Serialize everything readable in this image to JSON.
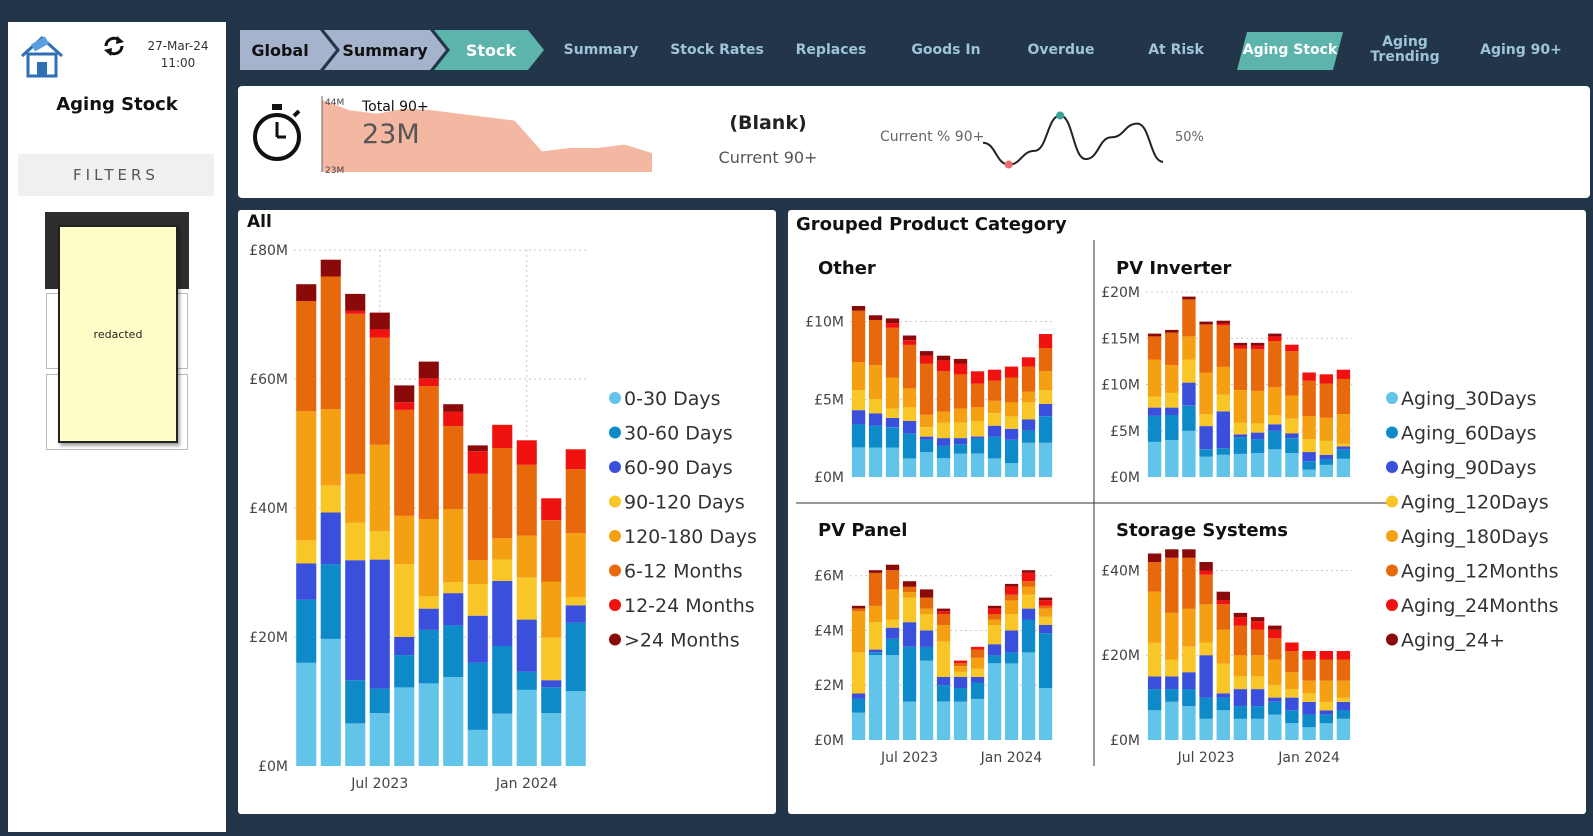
{
  "header": {
    "date": "27-Mar-24",
    "time": "11:00",
    "title": "Aging Stock",
    "filters_label": "FILTERS",
    "redacted_label": "redacted"
  },
  "breadcrumbs": [
    "Global",
    "Summary",
    "Stock"
  ],
  "tabs": [
    {
      "label": "Summary",
      "active": false
    },
    {
      "label": "Stock Rates",
      "active": false
    },
    {
      "label": "Replaces",
      "active": false
    },
    {
      "label": "Goods In",
      "active": false
    },
    {
      "label": "Overdue",
      "active": false
    },
    {
      "label": "At Risk",
      "active": false
    },
    {
      "label": "Aging Stock",
      "active": true
    },
    {
      "label": "Aging Trending",
      "active": false
    },
    {
      "label": "Aging 90+",
      "active": false
    }
  ],
  "kpi": {
    "sparkline_label": "Total 90+",
    "sparkline_value": "23M",
    "spark_max": "44M",
    "spark_min": "23M",
    "sparkline_values": [
      44,
      41,
      40,
      41.5,
      41,
      40,
      39,
      38,
      29,
      30,
      30,
      31,
      28.5
    ],
    "blank_value": "(Blank)",
    "blank_label": "Current 90+",
    "pct_label": "Current % 90+",
    "pct_value": "50%",
    "pct_values": [
      50,
      42,
      47,
      60,
      44,
      52,
      57,
      43
    ]
  },
  "colors": {
    "0-30": "#62c4e8",
    "30-60": "#0e8ac8",
    "60-90": "#3a4fdc",
    "90-120": "#f9c628",
    "120-180": "#f4a012",
    "6-12": "#e8680c",
    "12-24": "#f0120e",
    "24+": "#8a0a0a",
    "spark_fill": "#f4b7a2",
    "nav_crumb": "#a6b3cc",
    "nav_active": "#5cb4ad",
    "pct_high": "#3aa39b",
    "pct_low": "#f06a6a"
  },
  "chart_data": [
    {
      "type": "bar",
      "stacked": true,
      "title": "All",
      "ylim": [
        0,
        80
      ],
      "yticks": [
        "£0M",
        "£20M",
        "£40M",
        "£60M",
        "£80M"
      ],
      "xticks": [
        "Jul 2023",
        "Jan 2024"
      ],
      "categories": [
        "2023-04",
        "2023-05",
        "2023-06",
        "2023-07",
        "2023-08",
        "2023-09",
        "2023-10",
        "2023-11",
        "2023-12",
        "2024-01",
        "2024-02",
        "2024-03"
      ],
      "legend": [
        "0-30 Days",
        "30-60 Days",
        "60-90 Days",
        "90-120 Days",
        "120-180 Days",
        "6-12 Months",
        "12-24 Months",
        ">24 Months"
      ],
      "series": [
        {
          "name": "0-30 Days",
          "values": [
            16,
            19.7,
            6.6,
            8.2,
            12.2,
            12.8,
            13.8,
            5.6,
            8.1,
            11.8,
            8.2,
            11.6
          ]
        },
        {
          "name": "30-60 Days",
          "values": [
            9.8,
            11.6,
            6.7,
            3.8,
            5,
            8.3,
            8,
            10.4,
            10.5,
            2.8,
            4,
            10.6
          ]
        },
        {
          "name": "60-90 Days",
          "values": [
            5.6,
            8,
            18.6,
            20,
            2.8,
            3.3,
            5,
            7.3,
            10.1,
            8.1,
            1.1,
            2.7
          ]
        },
        {
          "name": "90-120 Days",
          "values": [
            3.6,
            4.2,
            5.8,
            4.4,
            11.3,
            1.9,
            1.7,
            4.9,
            3.3,
            6.5,
            6.6,
            1.3
          ]
        },
        {
          "name": "120-180 Days",
          "values": [
            20,
            11.8,
            7.6,
            13.4,
            7.5,
            12,
            11.3,
            3.7,
            3.3,
            6.5,
            8.7,
            9.9
          ]
        },
        {
          "name": "6-12 Months",
          "values": [
            17.1,
            20.6,
            24.8,
            16.6,
            16.4,
            20.6,
            12.9,
            13.4,
            14,
            11,
            9.5,
            9.9
          ]
        },
        {
          "name": "12-24 Months",
          "values": [
            0,
            0,
            0.5,
            1.3,
            1.2,
            1.2,
            2.2,
            3.5,
            3.6,
            3.8,
            3.4,
            3.1
          ]
        },
        {
          "name": ">24 Months",
          "values": [
            2.6,
            2.6,
            2.6,
            2.6,
            2.6,
            2.6,
            1.2,
            0.9,
            0,
            0,
            0,
            0
          ]
        }
      ]
    },
    {
      "type": "bar",
      "stacked": true,
      "title": "Grouped Product Category",
      "panels": [
        {
          "title": "Other",
          "ylim": [
            0,
            11
          ],
          "yticks": [
            "£0M",
            "£5M",
            "£10M"
          ],
          "xticks": [],
          "categories": [
            "2023-04",
            "2023-05",
            "2023-06",
            "2023-07",
            "2023-08",
            "2023-09",
            "2023-10",
            "2023-11",
            "2023-12",
            "2024-01",
            "2024-02",
            "2024-03"
          ],
          "series": [
            {
              "name": "Aging_30Days",
              "values": [
                1.9,
                1.9,
                1.9,
                1.2,
                1.6,
                1.2,
                1.5,
                1.5,
                1.2,
                0.9,
                2.2,
                2.2
              ]
            },
            {
              "name": "Aging_60Days",
              "values": [
                1.5,
                1.4,
                1.3,
                1.6,
                0.8,
                0.8,
                0.6,
                1.0,
                1.4,
                1.5,
                0.8,
                1.7
              ]
            },
            {
              "name": "Aging_90Days",
              "values": [
                0.9,
                0.8,
                0.6,
                0.8,
                0.2,
                0.5,
                0.4,
                0.1,
                0.7,
                0.7,
                0.7,
                0.8
              ]
            },
            {
              "name": "Aging_120Days",
              "values": [
                1.3,
                0.9,
                0.6,
                0.9,
                0.6,
                1.0,
                1.0,
                1.0,
                0.8,
                0.8,
                1.1,
                0.9
              ]
            },
            {
              "name": "Aging_180Days",
              "values": [
                1.8,
                2.2,
                2.0,
                1.2,
                0.8,
                0.7,
                0.9,
                0.9,
                0.8,
                0.9,
                0.7,
                1.2
              ]
            },
            {
              "name": "Aging_12Months",
              "values": [
                3.3,
                2.9,
                3.2,
                2.8,
                3.3,
                2.6,
                2.2,
                1.5,
                1.3,
                1.6,
                1.6,
                1.5
              ]
            },
            {
              "name": "Aging_24Months",
              "values": [
                0,
                0,
                0.3,
                0.3,
                0.5,
                0.7,
                0.7,
                0.8,
                0.7,
                0.7,
                0.6,
                0.9
              ]
            },
            {
              "name": "Aging_24+",
              "values": [
                0.3,
                0.3,
                0.3,
                0.3,
                0.3,
                0.3,
                0.3,
                0,
                0,
                0,
                0,
                0
              ]
            }
          ]
        },
        {
          "title": "PV Inverter",
          "ylim": [
            0,
            20
          ],
          "yticks": [
            "£0M",
            "£5M",
            "£10M",
            "£15M",
            "£20M"
          ],
          "xticks": [],
          "categories": [
            "2023-04",
            "2023-05",
            "2023-06",
            "2023-07",
            "2023-08",
            "2023-09",
            "2023-10",
            "2023-11",
            "2023-12",
            "2024-01",
            "2024-02",
            "2024-03"
          ],
          "series": [
            {
              "name": "Aging_30Days",
              "values": [
                3.8,
                4.0,
                5.0,
                2.2,
                2.4,
                2.5,
                2.6,
                3.0,
                2.6,
                0.8,
                1.3,
                2.0
              ]
            },
            {
              "name": "Aging_60Days",
              "values": [
                2.8,
                2.7,
                2.7,
                0.8,
                0.7,
                1.8,
                1.5,
                2.0,
                1.6,
                0.9,
                0.6,
                1.0
              ]
            },
            {
              "name": "Aging_90Days",
              "values": [
                0.9,
                0.8,
                2.5,
                2.5,
                4.0,
                0.3,
                0.7,
                0.7,
                0.5,
                1.0,
                0.5,
                0.3
              ]
            },
            {
              "name": "Aging_120Days",
              "values": [
                1.2,
                1.6,
                2.5,
                1.3,
                1.8,
                1.3,
                1.0,
                1.0,
                1.6,
                1.4,
                1.5,
                0.3
              ]
            },
            {
              "name": "Aging_180Days",
              "values": [
                4.0,
                3.0,
                2.5,
                4.5,
                3.0,
                3.5,
                3.5,
                3.0,
                2.5,
                2.5,
                2.5,
                3.2
              ]
            },
            {
              "name": "Aging_12Months",
              "values": [
                2.5,
                3.5,
                4.0,
                5.2,
                4.5,
                4.5,
                4.5,
                5.0,
                4.8,
                3.8,
                3.7,
                3.8
              ]
            },
            {
              "name": "Aging_24Months",
              "values": [
                0,
                0,
                0,
                0,
                0.2,
                0.3,
                0.4,
                0.5,
                0.7,
                0.9,
                1.0,
                1.0
              ]
            },
            {
              "name": "Aging_24+",
              "values": [
                0.3,
                0.3,
                0.3,
                0.3,
                0.3,
                0.3,
                0.3,
                0.3,
                0,
                0,
                0,
                0
              ]
            }
          ]
        },
        {
          "title": "PV Panel",
          "ylim": [
            0,
            6.5
          ],
          "yticks": [
            "£0M",
            "£2M",
            "£4M",
            "£6M"
          ],
          "xticks": [
            "Jul 2023",
            "Jan 2024"
          ],
          "categories": [
            "2023-04",
            "2023-05",
            "2023-06",
            "2023-07",
            "2023-08",
            "2023-09",
            "2023-10",
            "2023-11",
            "2023-12",
            "2024-01",
            "2024-02",
            "2024-03"
          ],
          "series": [
            {
              "name": "Aging_30Days",
              "values": [
                1.0,
                3.1,
                3.1,
                1.4,
                2.9,
                1.4,
                1.4,
                1.5,
                2.8,
                2.8,
                3.2,
                1.9
              ]
            },
            {
              "name": "Aging_60Days",
              "values": [
                0.5,
                0.1,
                0.6,
                2.0,
                0.5,
                0.6,
                0.5,
                0.6,
                0.3,
                0.4,
                1.2,
                2.0
              ]
            },
            {
              "name": "Aging_90Days",
              "values": [
                0.2,
                0.1,
                0.4,
                0.9,
                0.6,
                0.3,
                0.4,
                0.2,
                0.4,
                0.8,
                0.4,
                0.3
              ]
            },
            {
              "name": "Aging_120Days",
              "values": [
                1.5,
                1.0,
                0.3,
                0.9,
                0.6,
                1.3,
                0.2,
                0.3,
                0.7,
                0.6,
                0.5,
                0.3
              ]
            },
            {
              "name": "Aging_180Days",
              "values": [
                1.5,
                0.6,
                1.1,
                0.2,
                0.2,
                0.6,
                0.2,
                0.4,
                0.2,
                0.5,
                0.3,
                0.3
              ]
            },
            {
              "name": "Aging_12Months",
              "values": [
                0.1,
                1.2,
                0.7,
                0.2,
                0.4,
                0.4,
                0.1,
                0.3,
                0.2,
                0.2,
                0.2,
                0.1
              ]
            },
            {
              "name": "Aging_24Months",
              "values": [
                0,
                0,
                0,
                0,
                0,
                0.1,
                0.1,
                0.1,
                0.2,
                0.3,
                0.3,
                0.2
              ]
            },
            {
              "name": "Aging_24+",
              "values": [
                0.1,
                0.1,
                0.2,
                0.2,
                0.3,
                0.1,
                0,
                0,
                0.1,
                0.1,
                0.1,
                0.1
              ]
            }
          ]
        },
        {
          "title": "Storage Systems",
          "ylim": [
            0,
            42
          ],
          "yticks": [
            "£0M",
            "£20M",
            "£40M"
          ],
          "xticks": [
            "Jul 2023",
            "Jan 2024"
          ],
          "categories": [
            "2023-04",
            "2023-05",
            "2023-06",
            "2023-07",
            "2023-08",
            "2023-09",
            "2023-10",
            "2023-11",
            "2023-12",
            "2024-01",
            "2024-02",
            "2024-03"
          ],
          "series": [
            {
              "name": "Aging_30Days",
              "values": [
                7,
                9,
                8,
                5,
                7,
                5,
                5,
                6,
                4,
                3,
                4,
                5
              ]
            },
            {
              "name": "Aging_60Days",
              "values": [
                5,
                3,
                4,
                5,
                3,
                3,
                3,
                3,
                3,
                3,
                2,
                2
              ]
            },
            {
              "name": "Aging_90Days",
              "values": [
                3,
                3,
                4,
                10,
                1,
                4,
                4,
                1,
                3,
                3,
                1,
                2
              ]
            },
            {
              "name": "Aging_120Days",
              "values": [
                8,
                4,
                6,
                3,
                7,
                3,
                3,
                3,
                2,
                2,
                2,
                1
              ]
            },
            {
              "name": "Aging_180Days",
              "values": [
                12,
                11,
                9,
                9,
                8,
                5,
                5,
                6,
                4,
                3,
                5,
                4
              ]
            },
            {
              "name": "Aging_12Months",
              "values": [
                7,
                13,
                12,
                7,
                6,
                7,
                6,
                5,
                5,
                5,
                5,
                5
              ]
            },
            {
              "name": "Aging_24Months",
              "values": [
                0,
                0,
                0,
                1,
                1,
                2,
                2,
                2,
                2,
                2,
                2,
                2
              ]
            },
            {
              "name": "Aging_24+",
              "values": [
                2,
                2,
                2,
                2,
                2,
                1,
                1,
                1,
                0,
                0,
                0,
                0
              ]
            }
          ]
        }
      ],
      "legend": [
        "Aging_30Days",
        "Aging_60Days",
        "Aging_90Days",
        "Aging_120Days",
        "Aging_180Days",
        "Aging_12Months",
        "Aging_24Months",
        "Aging_24+"
      ]
    }
  ]
}
